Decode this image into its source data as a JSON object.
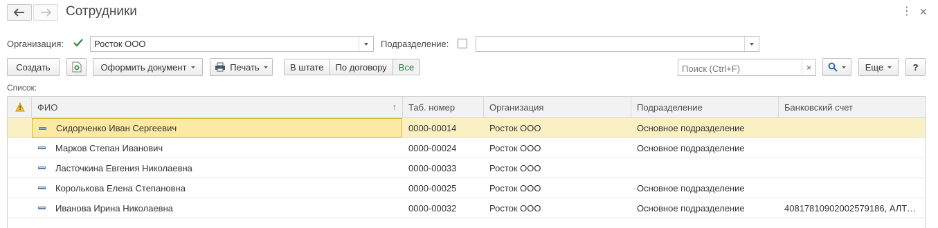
{
  "window": {
    "title": "Сотрудники",
    "back_icon": "arrow-left-icon",
    "forward_icon": "arrow-right-icon",
    "more_icon": "⋮",
    "close_icon": "✕"
  },
  "filters": {
    "organization_label": "Организация:",
    "organization_checked": true,
    "organization_value": "Росток ООО",
    "department_label": "Подразделение:",
    "department_checked": false,
    "department_value": ""
  },
  "toolbar": {
    "create_label": "Создать",
    "create_copy_icon": "add-document-icon",
    "issue_document_label": "Оформить документ",
    "print_label": "Печать",
    "print_icon": "printer-icon",
    "segments": [
      {
        "label": "В штате",
        "active": false
      },
      {
        "label": "По договору",
        "active": false
      },
      {
        "label": "Все",
        "active": true
      }
    ],
    "search_placeholder": "Поиск (Ctrl+F)",
    "search_clear": "×",
    "search_icon": "magnifier-icon",
    "more_label": "Еще",
    "help_label": "?"
  },
  "list": {
    "label": "Список:",
    "columns": [
      "ФИО",
      "Таб. номер",
      "Организация",
      "Подразделение",
      "Банковский счет"
    ],
    "sort_indicator": "↑",
    "warning_icon": "warning-triangle-icon",
    "rows": [
      {
        "fio": "Сидорченко Иван Сергеевич",
        "tab": "0000-00014",
        "org": "Росток ООО",
        "dept": "Основное подразделение",
        "bank": "",
        "selected": true
      },
      {
        "fio": "Марков Степан Иванович",
        "tab": "0000-00024",
        "org": "Росток ООО",
        "dept": "Основное подразделение",
        "bank": "",
        "selected": false
      },
      {
        "fio": "Ласточкина Евгения Николаевна",
        "tab": "0000-00033",
        "org": "Росток ООО",
        "dept": "",
        "bank": "",
        "selected": false
      },
      {
        "fio": "Королькова Елена Степановна",
        "tab": "0000-00025",
        "org": "Росток ООО",
        "dept": "Основное подразделение",
        "bank": "",
        "selected": false
      },
      {
        "fio": "Иванова Ирина Николаевна",
        "tab": "0000-00032",
        "org": "Росток ООО",
        "dept": "Основное подразделение",
        "bank": "40817810902002579186, АЛТ…",
        "selected": false
      }
    ]
  },
  "colors": {
    "accent_green": "#2b7a3a",
    "selection": "#fbf0c3",
    "focus": "#fce9a4"
  }
}
